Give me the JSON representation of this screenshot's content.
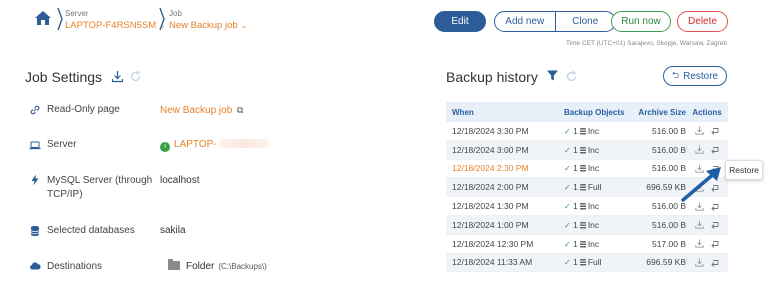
{
  "breadcrumb": {
    "server_label": "Server",
    "server_value": "LAPTOP-F4RSN5SM",
    "job_label": "Job",
    "job_value": "New Backup job"
  },
  "toolbar": {
    "edit": "Edit",
    "add_new": "Add new",
    "clone": "Clone",
    "run_now": "Run now",
    "delete": "Delete"
  },
  "timezone": "Time CET (UTC+01) Sarajevo, Skopje, Warsaw, Zagreb",
  "job_settings": {
    "title": "Job Settings",
    "rows": [
      {
        "label": "Read-Only page",
        "value": "New Backup job",
        "icon": "link-icon"
      },
      {
        "label": "Server",
        "value": "LAPTOP-",
        "icon": "laptop-icon"
      },
      {
        "label": "MySQL Server (through TCP/IP)",
        "value": "localhost",
        "icon": "bolt-icon"
      },
      {
        "label": "Selected databases",
        "value": "sakila",
        "icon": "database-icon"
      },
      {
        "label": "Destinations",
        "value": "Folder",
        "extra": "(C:\\Backups\\)",
        "icon": "cloud-icon"
      }
    ]
  },
  "backup_history": {
    "title": "Backup history",
    "restore_button": "Restore",
    "columns": [
      "When",
      "Backup Objects",
      "Archive Size",
      "Actions"
    ],
    "rows": [
      {
        "when": "12/18/2024  3:30 PM",
        "count": "1",
        "type": "Inc",
        "size": "516.00 B"
      },
      {
        "when": "12/18/2024  3:00 PM",
        "count": "1",
        "type": "Inc",
        "size": "516.00 B"
      },
      {
        "when": "12/18/2024  2:30 PM",
        "count": "1",
        "type": "Inc",
        "size": "516.00 B"
      },
      {
        "when": "12/18/2024  2:00 PM",
        "count": "1",
        "type": "Full",
        "size": "696.59 KB"
      },
      {
        "when": "12/18/2024  1:30 PM",
        "count": "1",
        "type": "Inc",
        "size": "516.00 B"
      },
      {
        "when": "12/18/2024  1:00 PM",
        "count": "1",
        "type": "Inc",
        "size": "516.00 B"
      },
      {
        "when": "12/18/2024  12:30 PM",
        "count": "1",
        "type": "Inc",
        "size": "517.00 B"
      },
      {
        "when": "12/18/2024  11:33 AM",
        "count": "1",
        "type": "Full",
        "size": "696.59 KB"
      }
    ],
    "tooltip": "Restore"
  },
  "colors": {
    "accent_blue": "#2d5d98",
    "accent_orange": "#e8822a",
    "success_green": "#3a9e47",
    "danger_red": "#d9534f"
  }
}
